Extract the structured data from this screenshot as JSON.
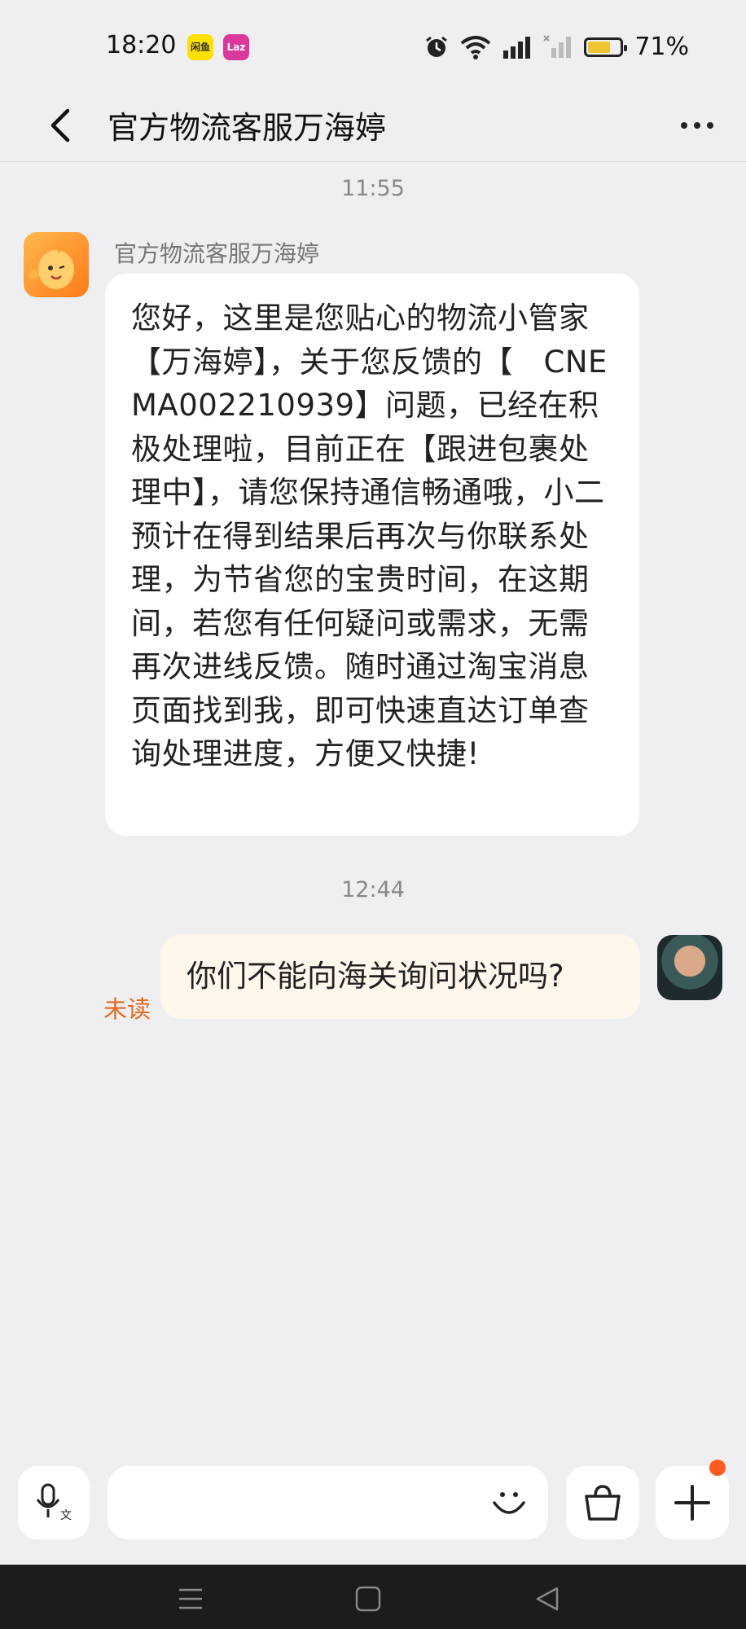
{
  "status_bar": {
    "time": "18:20",
    "app_badges": [
      {
        "name": "xianyu-app-icon",
        "text": "闲鱼",
        "color": "#ffe100"
      },
      {
        "name": "lazada-app-icon",
        "text": "Laz",
        "color": "#d9399a"
      }
    ],
    "icons": [
      "alarm-icon",
      "wifi-icon",
      "signal-icon",
      "signal-noservice-icon",
      "battery-icon"
    ],
    "battery_percent": "71%",
    "battery_level": 0.71
  },
  "header": {
    "title": "官方物流客服万海婷",
    "back_icon": "chevron-left-icon",
    "more_icon": "more-horizontal-icon"
  },
  "chat": {
    "timestamps": [
      "11:55",
      "12:44"
    ],
    "agent_message": {
      "sender_name": "官方物流客服万海婷",
      "text": "您好，这里是您贴心的物流小管家【万海婷】，关于您反馈的【　CNEMA002210939】问题，已经在积极处理啦，目前正在【跟进包裹处理中】，请您保持通信畅通哦，小二预计在得到结果后再次与你联系处理，为节省您的宝贵时间，在这期间，若您有任何疑问或需求，无需再次进线反馈。随时通过淘宝消息页面找到我，即可快速直达订单查询处理进度，方便又快捷!"
    },
    "user_message": {
      "text": "你们不能向海关询问状况吗?",
      "status": "未读"
    }
  },
  "input_bar": {
    "icons": [
      "voice-translate-icon",
      "emoji-icon",
      "shopping-bag-icon",
      "plus-icon"
    ],
    "placeholder": "",
    "accent": "#ff5a1f"
  },
  "nav_bar": {
    "icons": [
      "menu-icon",
      "home-icon",
      "back-triangle-icon"
    ]
  }
}
